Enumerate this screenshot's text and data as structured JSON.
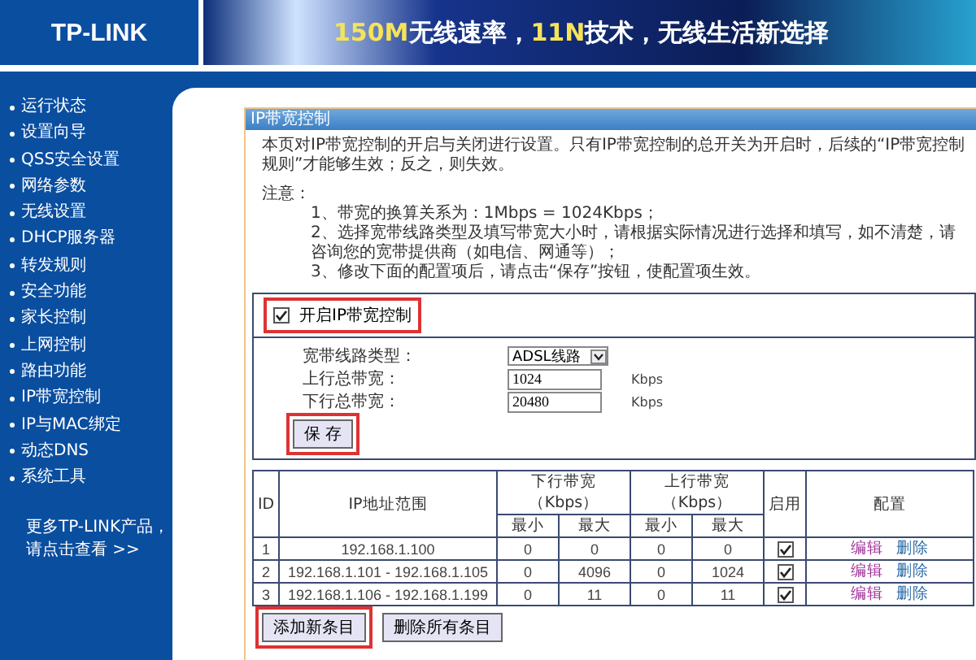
{
  "header": {
    "logo": "TP-LINK",
    "slogan": [
      {
        "text": "150M",
        "highlight": true
      },
      {
        "text": "无线速率，",
        "highlight": false
      },
      {
        "text": "11N",
        "highlight": true
      },
      {
        "text": "技术，无线生活新选择",
        "highlight": false
      }
    ]
  },
  "sidebar": {
    "items": [
      "运行状态",
      "设置向导",
      "QSS安全设置",
      "网络参数",
      "无线设置",
      "DHCP服务器",
      "转发规则",
      "安全功能",
      "家长控制",
      "上网控制",
      "路由功能",
      "IP带宽控制",
      "IP与MAC绑定",
      "动态DNS",
      "系统工具"
    ],
    "more": [
      "更多TP-LINK产品，",
      "请点击查看 >>"
    ]
  },
  "panel": {
    "title": "IP带宽控制",
    "intro": "本页对IP带宽控制的开启与关闭进行设置。只有IP带宽控制的总开关为开启时，后续的“IP带宽控制规则”才能够生效；反之，则失效。",
    "note_label": "注意：",
    "notes": [
      "1、带宽的换算关系为：1Mbps = 1024Kbps；",
      "2、选择宽带线路类型及填写带宽大小时，请根据实际情况进行选择和填写，如不清楚，请咨询您的宽带提供商（如电信、网通等）；",
      "3、修改下面的配置项后，请点击“保存”按钮，使配置项生效。"
    ]
  },
  "enable": {
    "label": "开启IP带宽控制",
    "checked": true,
    "highlighted": true
  },
  "settings": [
    {
      "kind": "select",
      "label": "宽带线路类型：",
      "value": "ADSL线路"
    },
    {
      "kind": "input",
      "label": "上行总带宽：",
      "value": "1024",
      "unit": "Kbps"
    },
    {
      "kind": "input",
      "label": "下行总带宽：",
      "value": "20480",
      "unit": "Kbps"
    }
  ],
  "save_button": {
    "label": "保 存",
    "highlighted": true
  },
  "table": {
    "headers": {
      "id": "ID",
      "range": "IP地址范围",
      "down": "下行带宽（Kbps）",
      "up": "上行带宽（Kbps）",
      "sub": [
        "最小",
        "最大",
        "最小",
        "最大"
      ],
      "enabled": "启用",
      "config": "配置"
    },
    "rows": [
      {
        "id": "1",
        "range": "192.168.1.100",
        "down_min": "0",
        "down_max": "0",
        "up_min": "0",
        "up_max": "0",
        "enabled": true,
        "edit": "编辑",
        "delete": "删除"
      },
      {
        "id": "2",
        "range": "192.168.1.101 - 192.168.1.105",
        "down_min": "0",
        "down_max": "4096",
        "up_min": "0",
        "up_max": "1024",
        "enabled": true,
        "edit": "编辑",
        "delete": "删除"
      },
      {
        "id": "3",
        "range": "192.168.1.106 - 192.168.1.199",
        "down_min": "0",
        "down_max": "11",
        "up_min": "0",
        "up_max": "11",
        "enabled": true,
        "edit": "编辑",
        "delete": "删除"
      }
    ]
  },
  "buttons": [
    {
      "label": "添加新条目",
      "highlighted": true
    },
    {
      "label": "删除所有条目",
      "highlighted": false
    }
  ]
}
